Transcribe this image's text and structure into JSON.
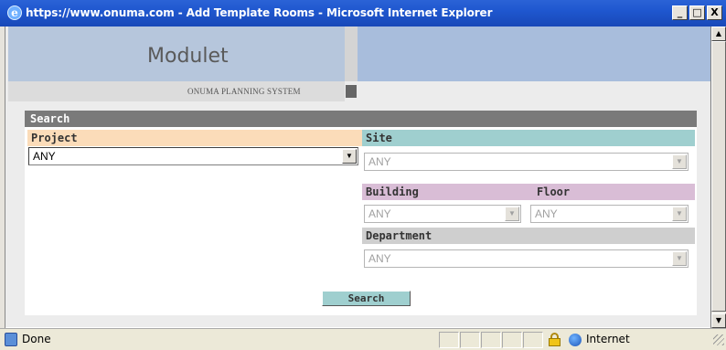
{
  "window": {
    "title": "https://www.onuma.com - Add Template Rooms - Microsoft Internet Explorer",
    "minimize": "_",
    "maximize": "□",
    "close": "X"
  },
  "header": {
    "app_name": "Modulet",
    "subtitle": "ONUMA PLANNING SYSTEM"
  },
  "search": {
    "heading": "Search",
    "project": {
      "label": "Project",
      "value": "ANY"
    },
    "site": {
      "label": "Site",
      "value": "ANY"
    },
    "building": {
      "label": "Building",
      "value": "ANY"
    },
    "floor": {
      "label": "Floor",
      "value": "ANY"
    },
    "department": {
      "label": "Department",
      "value": "ANY"
    },
    "button_label": "Search"
  },
  "statusbar": {
    "status": "Done",
    "zone": "Internet"
  },
  "colors": {
    "project_label_bg": "#fbdcb9",
    "site_label_bg": "#9fcfcf",
    "building_label_bg": "#d9bdd6",
    "department_label_bg": "#cfcfcf",
    "search_header_bg": "#7a7a7a",
    "title_bar": "#1f57cf"
  },
  "icons": {
    "browser": "ie-icon",
    "lock": "lock-icon",
    "zone": "globe-icon",
    "dropdown": "chevron-down-icon"
  }
}
